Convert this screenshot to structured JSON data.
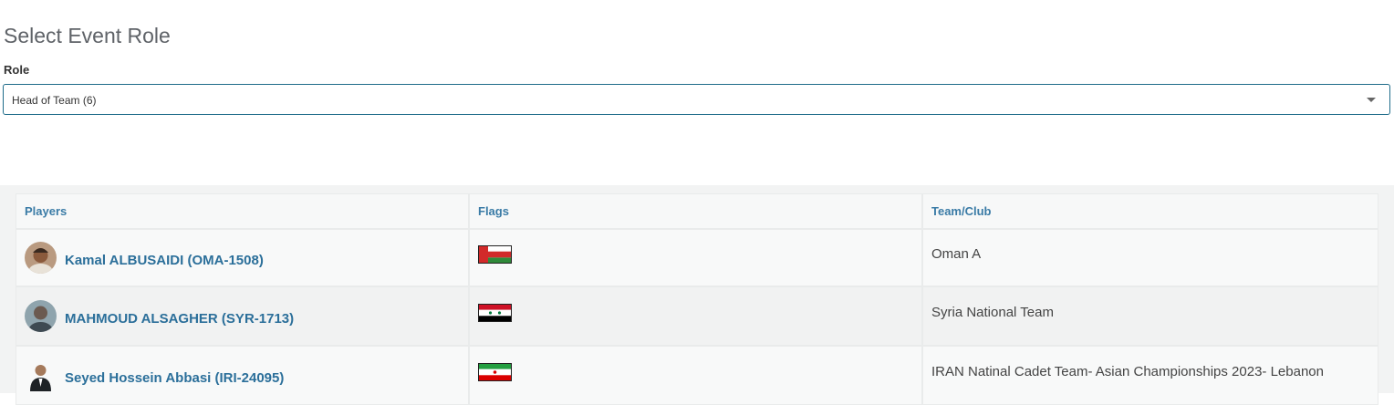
{
  "page": {
    "title": "Select Event Role"
  },
  "role": {
    "label": "Role",
    "selected": "Head of Team (6)"
  },
  "table": {
    "headers": {
      "players": "Players",
      "flags": "Flags",
      "team": "Team/Club"
    },
    "rows": [
      {
        "player": "Kamal ALBUSAIDI (OMA-1508)",
        "flag": "oman-flag",
        "team": "Oman A"
      },
      {
        "player": "MAHMOUD ALSAGHER (SYR-1713)",
        "flag": "syria-flag",
        "team": "Syria National Team"
      },
      {
        "player": "Seyed Hossein Abbasi (IRI-24095)",
        "flag": "iran-flag",
        "team": "IRAN Natinal Cadet Team- Asian Championships 2023- Lebanon"
      }
    ]
  },
  "colors": {
    "accent": "#2b6f9a",
    "header_text": "#3a7ba6",
    "select_border": "#1f6c8a"
  }
}
